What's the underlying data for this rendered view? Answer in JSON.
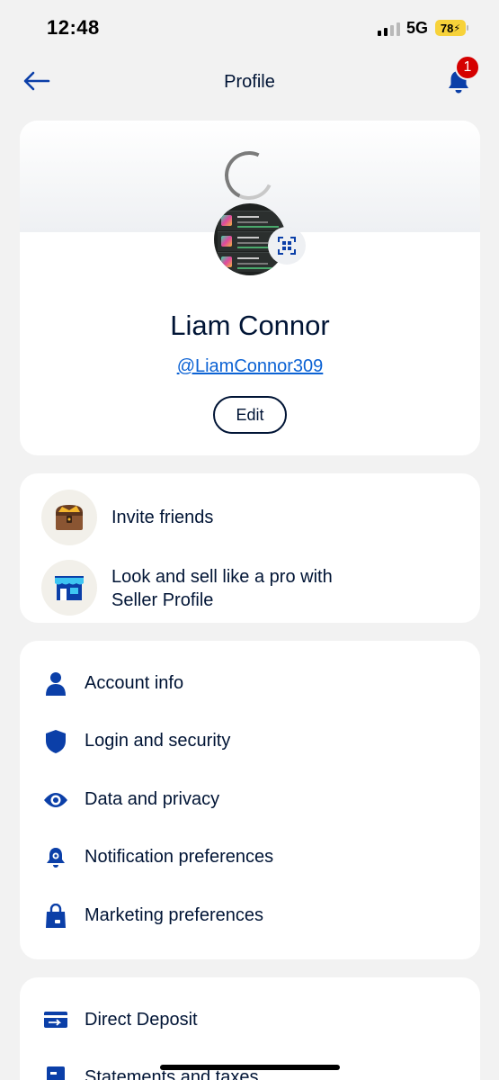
{
  "status_bar": {
    "time": "12:48",
    "network": "5G",
    "battery": "78"
  },
  "nav": {
    "title": "Profile",
    "notification_count": "1"
  },
  "profile": {
    "name": "Liam Connor",
    "handle": "@LiamConnor309",
    "edit_label": "Edit"
  },
  "promos": [
    {
      "label": "Invite friends",
      "icon": "treasure-chest-icon"
    },
    {
      "label": "Look and sell like a pro with\nSeller Profile",
      "icon": "storefront-icon"
    }
  ],
  "menu": [
    {
      "label": "Account info",
      "icon": "person-icon"
    },
    {
      "label": "Login and security",
      "icon": "shield-icon"
    },
    {
      "label": "Data and privacy",
      "icon": "eye-icon"
    },
    {
      "label": "Notification preferences",
      "icon": "bell-gear-icon"
    },
    {
      "label": "Marketing preferences",
      "icon": "shopping-bag-icon"
    }
  ],
  "menu2": [
    {
      "label": "Direct Deposit",
      "icon": "deposit-icon"
    },
    {
      "label": "Statements and taxes",
      "icon": "document-icon"
    }
  ],
  "colors": {
    "brand": "#0b3fa8",
    "link": "#0b62d4",
    "badge": "#d50000",
    "text": "#001435",
    "battery": "#f7d23a"
  }
}
